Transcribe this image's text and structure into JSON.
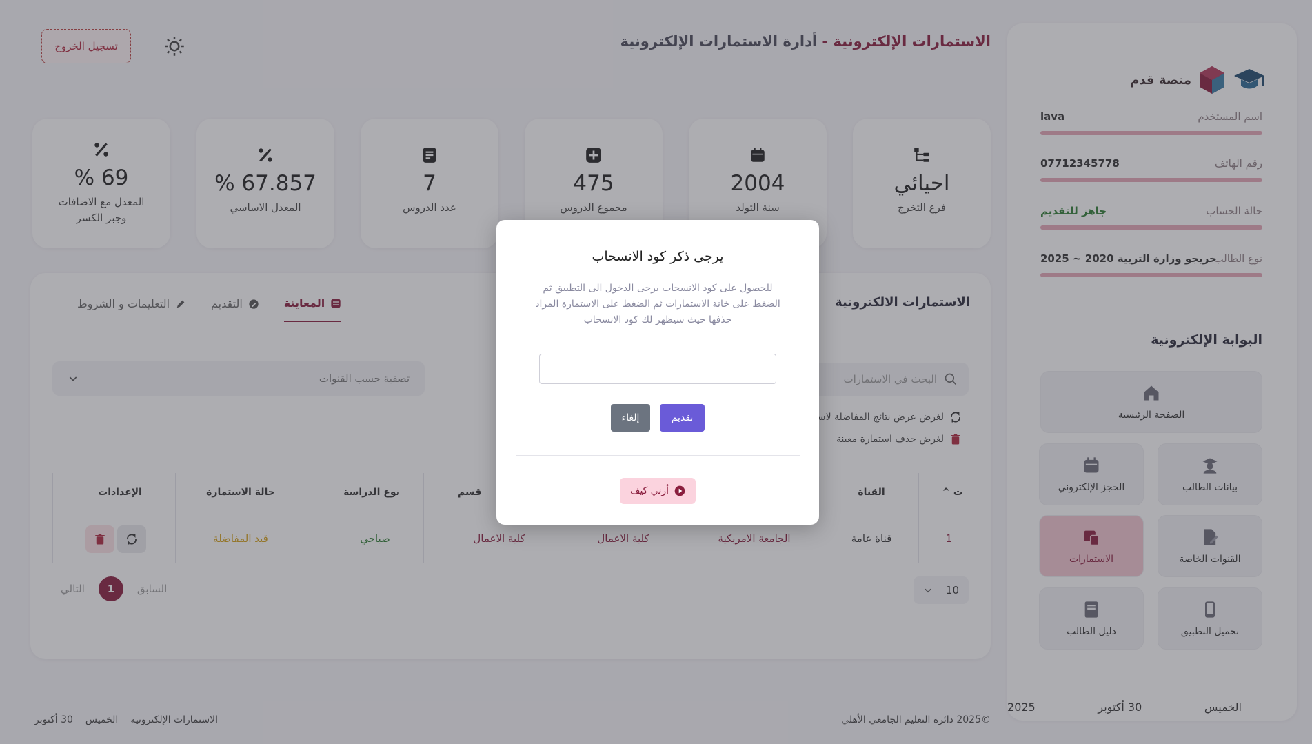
{
  "brand": {
    "name": "منصة قدم"
  },
  "header": {
    "title_part1": "الاستمارات الإلكترونية -",
    "title_part2": "أدارة الاستمارات الإلكترونية",
    "logout_label": "تسجيل الخروج"
  },
  "profile": [
    {
      "label": "اسم المستخدم",
      "value": "lava",
      "value_color": "#333333"
    },
    {
      "label": "رقم الهاتف",
      "value": "07712345778",
      "value_color": "#333333"
    },
    {
      "label": "حالة الحساب",
      "value": "جاهز للتقديم",
      "value_color": "#2e7d32"
    },
    {
      "label": "نوع الطالب",
      "value": "خريجو وزارة التربية 2020 ~ 2025",
      "value_color": "#333333"
    }
  ],
  "portal": {
    "title": "البوابة الإلكترونية",
    "tiles": [
      {
        "label": "الصفحة الرئيسية",
        "icon": "home-icon"
      },
      {
        "label": "بيانات الطالب",
        "icon": "student-icon"
      },
      {
        "label": "الحجز الإلكتروني",
        "icon": "calendar-icon"
      },
      {
        "label": "القنوات الخاصة",
        "icon": "file-edit-icon"
      },
      {
        "label": "الاستمارات",
        "icon": "forms-icon"
      },
      {
        "label": "تحميل التطبيق",
        "icon": "phone-icon"
      },
      {
        "label": "دليل الطالب",
        "icon": "book-icon"
      }
    ]
  },
  "sidebar_date": {
    "day": "الخميس",
    "date": "30 أكتوبر",
    "year": "2025"
  },
  "stats": [
    {
      "value": "احيائي",
      "label": "فرع التخرج",
      "icon": "branch-icon"
    },
    {
      "value": "2004",
      "label": "سنة التولد",
      "icon": "calendar-icon"
    },
    {
      "value": "475",
      "label": "مجموع الدروس",
      "icon": "plus-icon"
    },
    {
      "value": "7",
      "label": "عدد الدروس",
      "icon": "book-icon"
    },
    {
      "value": "67.857 %",
      "label": "المعدل الاساسي",
      "icon": "percent-icon"
    },
    {
      "value": "69 %",
      "label": "المعدل مع الاضافات وجبر الكسر",
      "icon": "percent-icon"
    }
  ],
  "panel": {
    "title": "الاستمارات الالكترونية",
    "tabs": [
      "المعاينة",
      "التقديم",
      "التعليمات و الشروط"
    ],
    "search_placeholder": "البحث في الاستمارات",
    "filter_placeholder": "تصفية حسب القنوات",
    "hint1": "لغرض عرض نتائج المفاضلة لاستما",
    "hint2": "لغرض حذف استمارة معينة"
  },
  "table": {
    "headers": [
      "ت",
      "القناة",
      "",
      "قسم",
      "نوع الدراسة",
      "حالة الاستمارة",
      "الإعدادات"
    ],
    "row": {
      "n": "1",
      "channel": "قناة عامة",
      "university": "الجامعة الامريكية",
      "college": "كلية الاعمال",
      "dept": "كلية الاعمال",
      "study": "صباحي",
      "status": "قيد المفاضلة"
    }
  },
  "pagination": {
    "prev": "السابق",
    "page": "1",
    "next": "التالي",
    "per_page": "10"
  },
  "footer": {
    "right": "©2025 دائرة التعليم الجامعي الأهلي",
    "left_section": "الاستمارات الإلكترونية",
    "left_day": "الخميس",
    "left_date": "30 أكتوبر"
  },
  "modal": {
    "title": "يرجى ذكر كود الانسحاب",
    "description": "للحصول على كود الانسحاب يرجى الدخول الى التطبيق ثم الضغط على خانة الاستمارات ثم الضغط على الاستمارة المراد حذفها حيث سيظهر لك كود الانسحاب",
    "input_value": "",
    "submit_label": "تقديم",
    "cancel_label": "إلغاء",
    "show_how_label": "أرني كيف"
  },
  "colors": {
    "brand": "#8a1e3e",
    "submit": "#6a5bd8",
    "cancel": "#6c7480",
    "status_pending": "#d4a017",
    "status_active": "#2e7d32"
  }
}
